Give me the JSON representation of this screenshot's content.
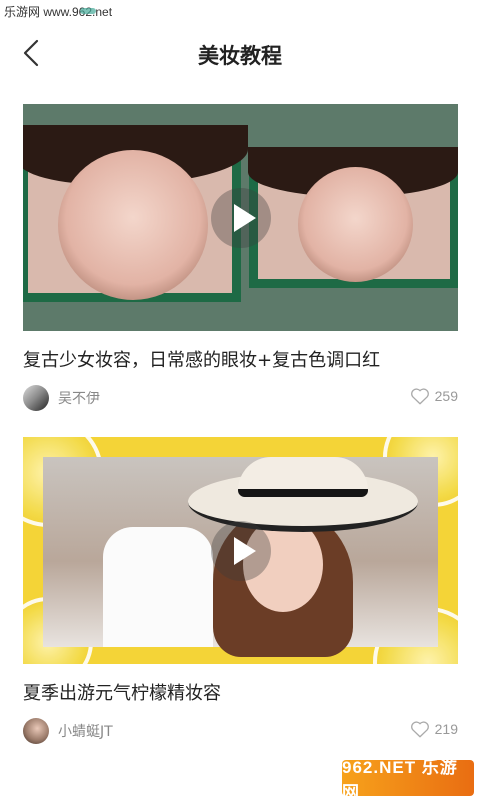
{
  "status_bar": {
    "watermark": "乐游网 www.962.net"
  },
  "header": {
    "title": "美妆教程",
    "back_icon": "chevron-left-icon"
  },
  "videos": [
    {
      "title": "复古少女妆容，日常感的眼妆+复古色调口红",
      "author": "吴不伊",
      "likes": "259"
    },
    {
      "title": "夏季出游元气柠檬精妆容",
      "author": "小蜻蜓JT",
      "likes": "219"
    }
  ],
  "watermark_logo": "962.NET 乐游网",
  "colors": {
    "accent_green": "#1e6a45",
    "lemon_yellow": "#f4d437",
    "text_dark": "#222222",
    "text_gray": "#888888"
  }
}
